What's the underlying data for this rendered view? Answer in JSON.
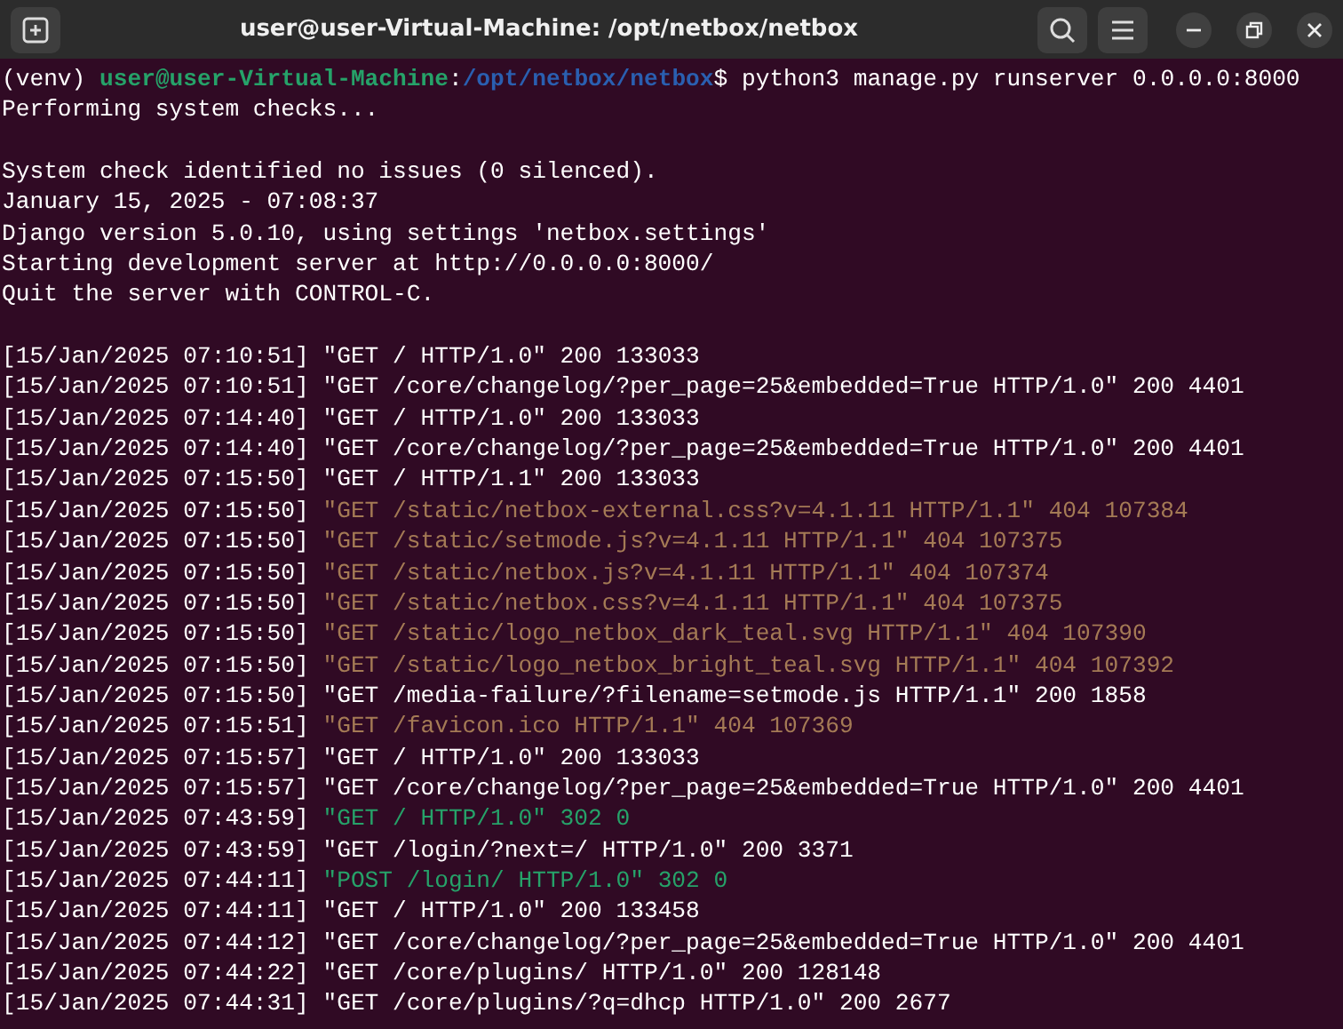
{
  "window": {
    "title": "user@user-Virtual-Machine: /opt/netbox/netbox"
  },
  "prompt": {
    "env": "(venv) ",
    "user": "user@user-Virtual-Machine",
    "sep": ":",
    "path": "/opt/netbox/netbox",
    "symbol": "$ ",
    "command": "python3 manage.py runserver 0.0.0.0:8000"
  },
  "output": [
    {
      "kind": "text",
      "text": "Performing system checks..."
    },
    {
      "kind": "blank"
    },
    {
      "kind": "text",
      "text": "System check identified no issues (0 silenced)."
    },
    {
      "kind": "text",
      "text": "January 15, 2025 - 07:08:37"
    },
    {
      "kind": "text",
      "text": "Django version 5.0.10, using settings 'netbox.settings'"
    },
    {
      "kind": "text",
      "text": "Starting development server at http://0.0.0.0:8000/"
    },
    {
      "kind": "text",
      "text": "Quit the server with CONTROL-C."
    },
    {
      "kind": "blank"
    }
  ],
  "log": [
    {
      "time": "[15/Jan/2025 07:10:51]",
      "request": "\"GET / HTTP/1.0\" 200 133033",
      "color": "#ffffff"
    },
    {
      "time": "[15/Jan/2025 07:10:51]",
      "request": "\"GET /core/changelog/?per_page=25&embedded=True HTTP/1.0\" 200 4401",
      "color": "#ffffff"
    },
    {
      "time": "[15/Jan/2025 07:14:40]",
      "request": "\"GET / HTTP/1.0\" 200 133033",
      "color": "#ffffff"
    },
    {
      "time": "[15/Jan/2025 07:14:40]",
      "request": "\"GET /core/changelog/?per_page=25&embedded=True HTTP/1.0\" 200 4401",
      "color": "#ffffff"
    },
    {
      "time": "[15/Jan/2025 07:15:50]",
      "request": "\"GET / HTTP/1.1\" 200 133033",
      "color": "#ffffff"
    },
    {
      "time": "[15/Jan/2025 07:15:50]",
      "request": "\"GET /static/netbox-external.css?v=4.1.11 HTTP/1.1\" 404 107384",
      "color": "#a47a55"
    },
    {
      "time": "[15/Jan/2025 07:15:50]",
      "request": "\"GET /static/setmode.js?v=4.1.11 HTTP/1.1\" 404 107375",
      "color": "#a47a55"
    },
    {
      "time": "[15/Jan/2025 07:15:50]",
      "request": "\"GET /static/netbox.js?v=4.1.11 HTTP/1.1\" 404 107374",
      "color": "#a47a55"
    },
    {
      "time": "[15/Jan/2025 07:15:50]",
      "request": "\"GET /static/netbox.css?v=4.1.11 HTTP/1.1\" 404 107375",
      "color": "#a47a55"
    },
    {
      "time": "[15/Jan/2025 07:15:50]",
      "request": "\"GET /static/logo_netbox_dark_teal.svg HTTP/1.1\" 404 107390",
      "color": "#a47a55"
    },
    {
      "time": "[15/Jan/2025 07:15:50]",
      "request": "\"GET /static/logo_netbox_bright_teal.svg HTTP/1.1\" 404 107392",
      "color": "#a47a55"
    },
    {
      "time": "[15/Jan/2025 07:15:50]",
      "request": "\"GET /media-failure/?filename=setmode.js HTTP/1.1\" 200 1858",
      "color": "#ffffff"
    },
    {
      "time": "[15/Jan/2025 07:15:51]",
      "request": "\"GET /favicon.ico HTTP/1.1\" 404 107369",
      "color": "#a47a55"
    },
    {
      "time": "[15/Jan/2025 07:15:57]",
      "request": "\"GET / HTTP/1.0\" 200 133033",
      "color": "#ffffff"
    },
    {
      "time": "[15/Jan/2025 07:15:57]",
      "request": "\"GET /core/changelog/?per_page=25&embedded=True HTTP/1.0\" 200 4401",
      "color": "#ffffff"
    },
    {
      "time": "[15/Jan/2025 07:43:59]",
      "request": "\"GET / HTTP/1.0\" 302 0",
      "color": "#26a269"
    },
    {
      "time": "[15/Jan/2025 07:43:59]",
      "request": "\"GET /login/?next=/ HTTP/1.0\" 200 3371",
      "color": "#ffffff"
    },
    {
      "time": "[15/Jan/2025 07:44:11]",
      "request": "\"POST /login/ HTTP/1.0\" 302 0",
      "color": "#26a269"
    },
    {
      "time": "[15/Jan/2025 07:44:11]",
      "request": "\"GET / HTTP/1.0\" 200 133458",
      "color": "#ffffff"
    },
    {
      "time": "[15/Jan/2025 07:44:12]",
      "request": "\"GET /core/changelog/?per_page=25&embedded=True HTTP/1.0\" 200 4401",
      "color": "#ffffff"
    },
    {
      "time": "[15/Jan/2025 07:44:22]",
      "request": "\"GET /core/plugins/ HTTP/1.0\" 200 128148",
      "color": "#ffffff"
    },
    {
      "time": "[15/Jan/2025 07:44:31]",
      "request": "\"GET /core/plugins/?q=dhcp HTTP/1.0\" 200 2677",
      "color": "#ffffff"
    }
  ]
}
